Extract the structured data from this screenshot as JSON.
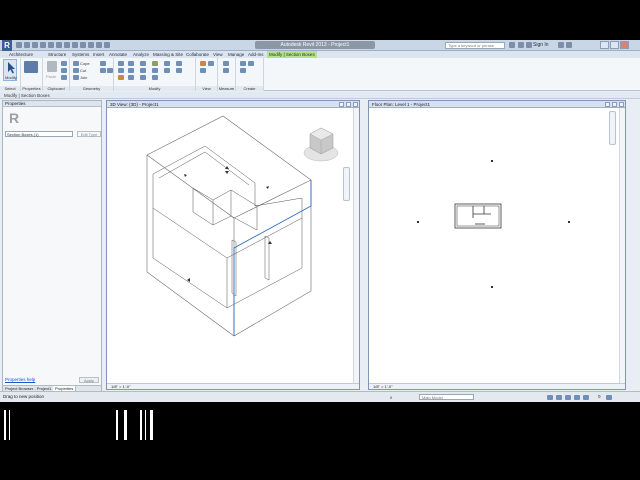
{
  "app": {
    "logo_letter": "R",
    "title": "Autodesk Revit 2013 - Project1",
    "search_placeholder": "Type a keyword or phrase",
    "sign_in": "Sign In"
  },
  "ribbon": {
    "tabs": [
      "Architecture",
      "Structure",
      "Systems",
      "Insert",
      "Annotate",
      "Analyze",
      "Massing & Site",
      "Collaborate",
      "View",
      "Manage",
      "Add-Ins",
      "Modify | Section Boxes"
    ],
    "active_tab": "Modify | Section Boxes",
    "modify_label": "Modify",
    "panels": [
      "Select",
      "Properties",
      "Clipboard",
      "Geometry",
      "Modify",
      "View",
      "Measure",
      "Create"
    ],
    "clipboard_items": [
      "Paste"
    ],
    "geometry_items": [
      "Cope",
      "Cut",
      "Join"
    ]
  },
  "context_label": "Modify | Section Boxes",
  "properties": {
    "header": "Properties",
    "logo": "R",
    "type_selector": "Section Boxes (1)",
    "edit_type": "Edit Type",
    "help_link": "Properties help",
    "apply": "Apply",
    "tabs": [
      "Project Browser - Project1",
      "Properties"
    ]
  },
  "views": {
    "left": {
      "title": "3D View: {3D} - Project1",
      "scale": "1/8\" = 1'-0\""
    },
    "right": {
      "title": "Floor Plan: Level 1 - Project1",
      "scale": "1/8\" = 1'-0\""
    }
  },
  "status": {
    "message": "Drag to new position",
    "workset": "0",
    "model": "Main Model",
    "selection": "0"
  },
  "colors": {
    "accent_tab": "#b6e08c",
    "section_box": "#2e6cc4"
  }
}
